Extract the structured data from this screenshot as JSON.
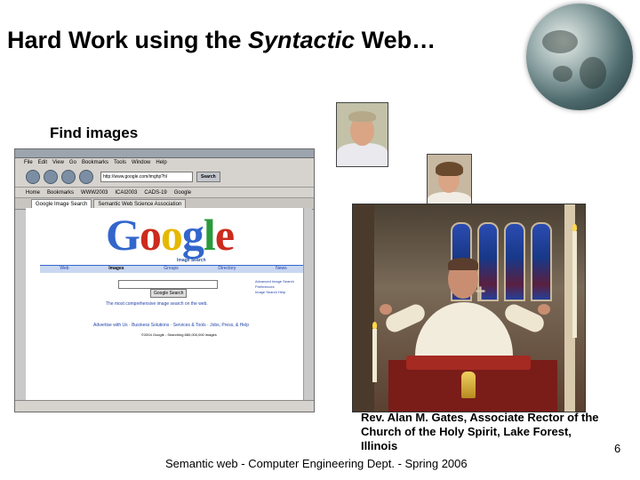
{
  "slide": {
    "title_part1": "Hard Work using the ",
    "title_italic": "Syntactic",
    "title_part2": " Web…",
    "subheading": "Find images",
    "caption": "Rev. Alan M. Gates, Associate Rector of the Church of the Holy Spirit, Lake Forest, Illinois",
    "footer": "Semantic web - Computer Engineering Dept. - Spring 2006",
    "page_number": "6"
  },
  "browser": {
    "menu": [
      "File",
      "Edit",
      "View",
      "Go",
      "Bookmarks",
      "Tools",
      "Window",
      "Help"
    ],
    "url": "http://www.google.com/imghp?hl",
    "search_button": "Search",
    "bookmarks": [
      "Home",
      "Bookmarks",
      "WWW2003",
      "ICAI2003",
      "CADS-19",
      "Google"
    ],
    "tabs": [
      "Google Image Search",
      "Semantic Web Science Association"
    ],
    "page": {
      "logo_letters": [
        "G",
        "o",
        "o",
        "g",
        "l",
        "e"
      ],
      "logo_sub": "Image Search",
      "nav_tabs": [
        "Web",
        "Images",
        "Groups",
        "Directory",
        "News"
      ],
      "search_button": "Google Search",
      "side_links": [
        "Advanced Image Search",
        "Preferences",
        "Image Search Help"
      ],
      "tagline": "The most comprehensive image search on the web.",
      "footer_links": "Advertise with Us · Business Solutions · Services & Tools · Jobs, Press, & Help",
      "copyright": "©2004 Google - Searching 880,000,000 images"
    }
  },
  "colors": {
    "google_blue": "#3366cc",
    "google_red": "#cc2b1d",
    "google_yellow": "#e6b800",
    "google_green": "#2a9a3c"
  }
}
